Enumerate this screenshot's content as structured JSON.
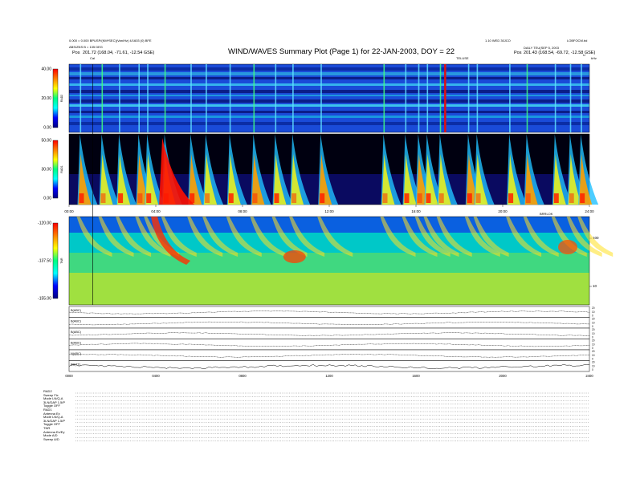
{
  "header": {
    "title": "WIND/WAVES Summary Plot (Page 1) for 22-JAN-2003, DOY = 22",
    "left_line1": "0.000 = 0.000 BPUSP/(KM*SEC)(Van/Hz)   4/1603 (0) BFE",
    "left_line2": "ABS/ZNS B = 135 DEG",
    "left_pos_label": "Pos",
    "left_pos": "201.72 (168.04, -71.61, -12.54 GSE)",
    "right_line1": "1.10 WED 30JCO",
    "right_line2": "DAILY  TEU(SEP 5, 2003",
    "right_corner": "LOBFOCM.bd",
    "right_pos_label": "Pos",
    "right_pos": "201.43 (168.54, -69.72, -12.58 GSE)",
    "marker_top": "Cal",
    "marker_mid": "TELUSE",
    "marker_right": "U",
    "marker_units": "kHz",
    "marker_panel3": "BRRLOK"
  },
  "colors": {
    "background": "#ffffff",
    "colorbar": [
      "#000080",
      "#0000ff",
      "#00ffff",
      "#00ff80",
      "#ffff00",
      "#ff8000",
      "#ff0000"
    ]
  },
  "footer": {
    "lines": [
      "RAD2",
      "Sweep     Fix",
      "Mode  LN/Q-A",
      "3LN/DAP 1.5/P",
      "Toggle     OFF",
      "RAD1",
      "Antenna       Ex",
      "Mode  LN/Q-A",
      "3LN/DAP 1.5/P",
      "Toggle     OFF",
      "TNR",
      "Antenna  Ex/Ey",
      "Mode          A/D",
      "Sweep        A/D"
    ]
  },
  "chart_data": [
    {
      "type": "heatmap",
      "name_label": "RAD2",
      "ylabel": "RAD2",
      "yticks": [
        "40.00",
        "20.00",
        "0.00"
      ],
      "ylim": [
        0,
        40
      ],
      "xlim": [
        0,
        24
      ],
      "xticks": [
        "00:00",
        "04:00",
        "08:00",
        "12:00",
        "16:00",
        "20:00",
        "24:00"
      ],
      "colorbar": true,
      "description_values": {
        "burst_hours": [
          0.5,
          1.5,
          2.3,
          3.2,
          3.6,
          4.4,
          5.6,
          6.3,
          7.4,
          8.5,
          9.5,
          10.3,
          11.6,
          14.5,
          15.5,
          16.1,
          16.5,
          17.1,
          18.4,
          18.8,
          20.3,
          21.1,
          22.4,
          23.1,
          23.6
        ]
      }
    },
    {
      "type": "heatmap",
      "name_label": "RAD1",
      "ylabel": "RAD1",
      "yticks": [
        "50.00",
        "30.00",
        "0.00"
      ],
      "ylim": [
        0,
        50
      ],
      "xlim": [
        0,
        24
      ],
      "xticks": [
        "00:00",
        "04:00",
        "08:00",
        "12:00",
        "16:00",
        "20:00",
        "24:00"
      ],
      "colorbar": true
    },
    {
      "type": "heatmap",
      "name_label": "TNR",
      "ylabel": "TNR",
      "yticks": [
        "-120.00",
        "-137.50",
        "-155.00"
      ],
      "ylim": [
        -155,
        -120
      ],
      "xlim": [
        0,
        24
      ],
      "right_yticks": [
        "100",
        "10"
      ],
      "colorbar": true
    },
    {
      "type": "line",
      "panels": [
        {
          "label": "B(ABC)",
          "right_ticks": [
            "20",
            "10",
            "0"
          ]
        },
        {
          "label": "B(ABC)",
          "right_ticks": [
            "20",
            "10",
            "0"
          ]
        },
        {
          "label": "B(ABC)",
          "right_ticks": [
            "20",
            "10",
            "0"
          ]
        },
        {
          "label": "B(ABC)",
          "right_ticks": [
            "20",
            "10",
            "0"
          ]
        },
        {
          "label": "N(ABC)",
          "right_ticks": [
            "20",
            "10",
            "0"
          ]
        },
        {
          "label": "BB(TT)",
          "right_ticks": [
            "20",
            "10",
            "0"
          ]
        }
      ],
      "xticks": [
        "0000",
        "0400",
        "0800",
        "1200",
        "1600",
        "2000",
        "2400"
      ],
      "xlim": [
        0,
        24
      ]
    }
  ]
}
